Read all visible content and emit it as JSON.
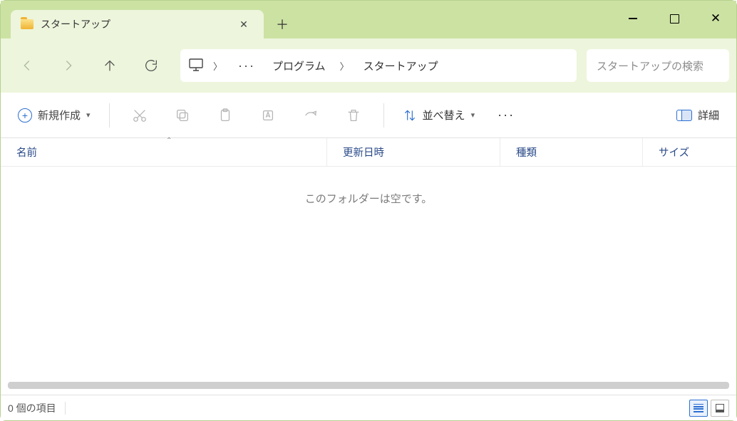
{
  "window": {
    "tab_title": "スタートアップ"
  },
  "breadcrumb": {
    "items": [
      "プログラム",
      "スタートアップ"
    ]
  },
  "search": {
    "placeholder": "スタートアップの検索"
  },
  "toolbar": {
    "new_label": "新規作成",
    "sort_label": "並べ替え",
    "details_label": "詳細"
  },
  "columns": {
    "name": "名前",
    "modified": "更新日時",
    "type": "種類",
    "size": "サイズ"
  },
  "main": {
    "empty_message": "このフォルダーは空です。"
  },
  "status": {
    "item_count": "0 個の項目"
  }
}
